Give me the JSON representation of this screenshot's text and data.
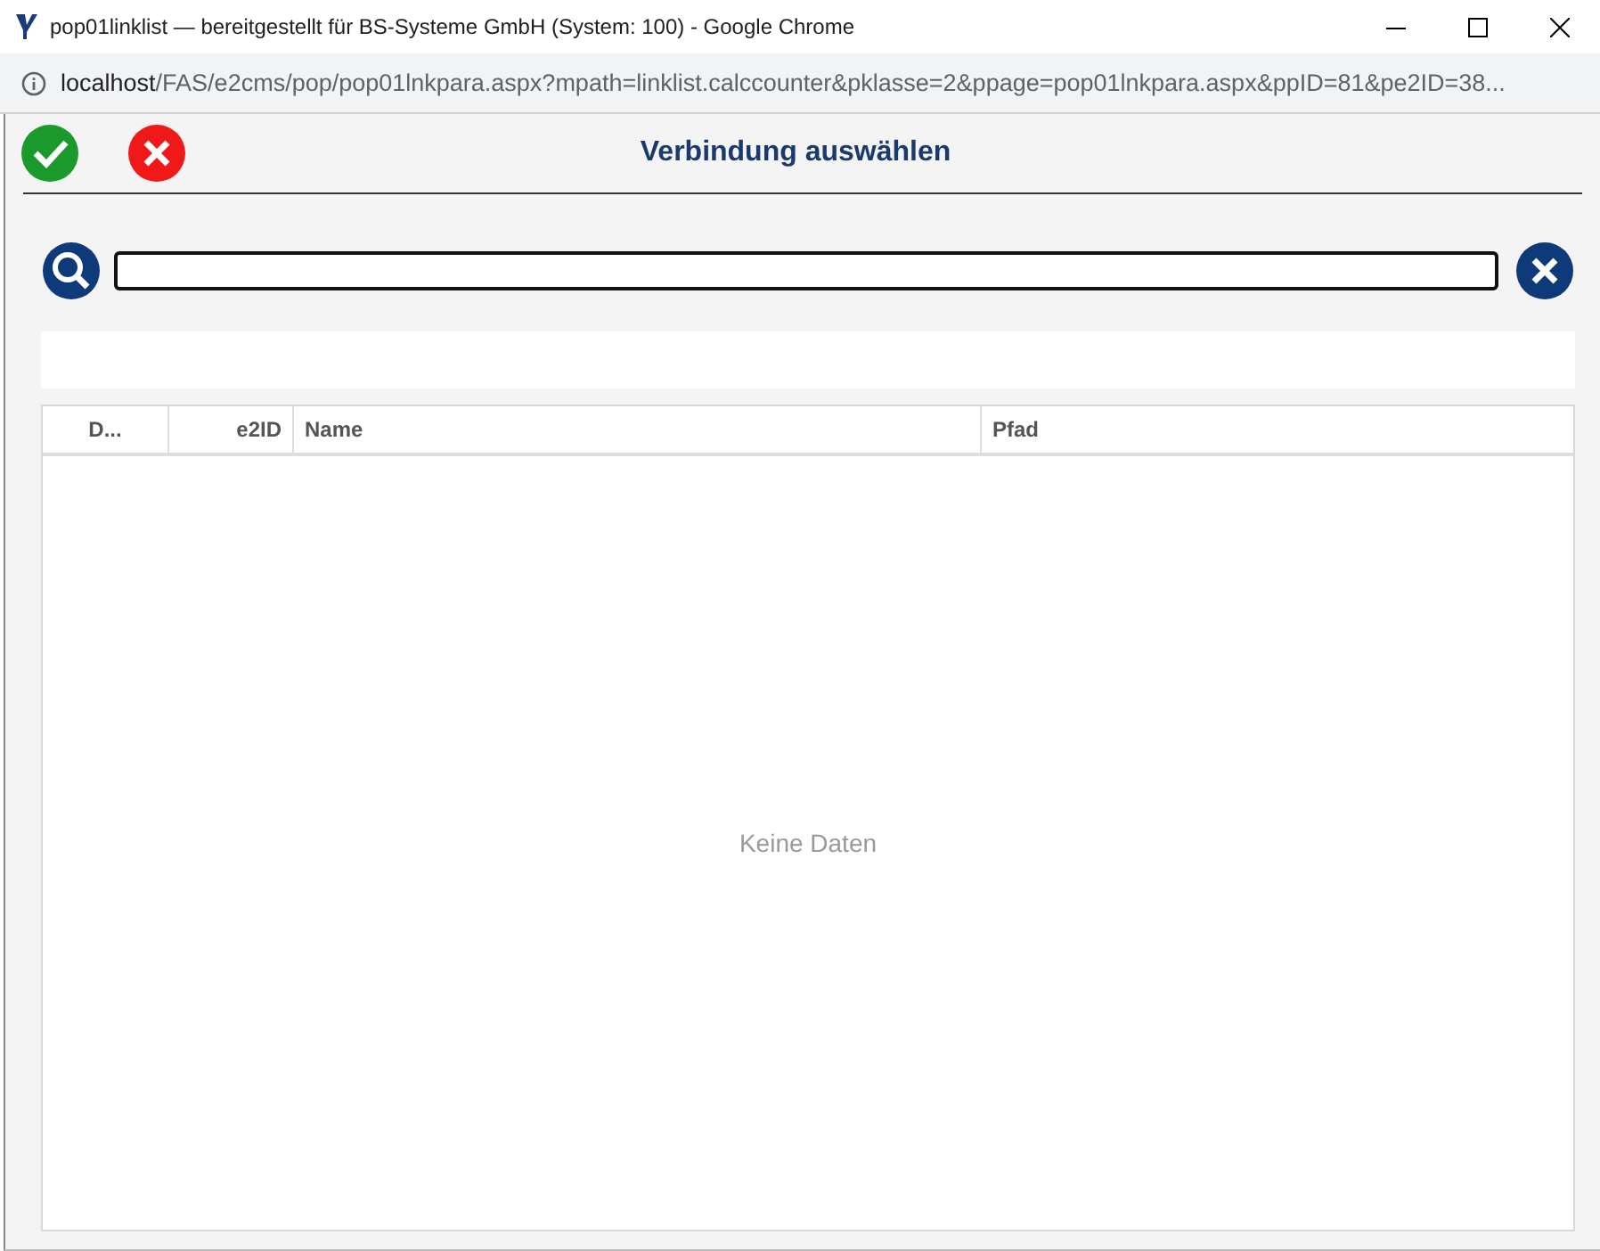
{
  "window": {
    "title": "pop01linklist — bereitgestellt für BS-Systeme GmbH (System: 100) - Google Chrome"
  },
  "address_bar": {
    "host": "localhost",
    "path": "/FAS/e2cms/pop/pop01lnkpara.aspx?mpath=linklist.calccounter&pklasse=2&ppage=pop01lnkpara.aspx&ppID=81&pe2ID=38..."
  },
  "dialog": {
    "title": "Verbindung auswählen"
  },
  "table": {
    "columns": [
      {
        "label": "D..."
      },
      {
        "label": "e2ID"
      },
      {
        "label": "Name"
      },
      {
        "label": "Pfad"
      }
    ],
    "empty_text": "Keine Daten"
  }
}
